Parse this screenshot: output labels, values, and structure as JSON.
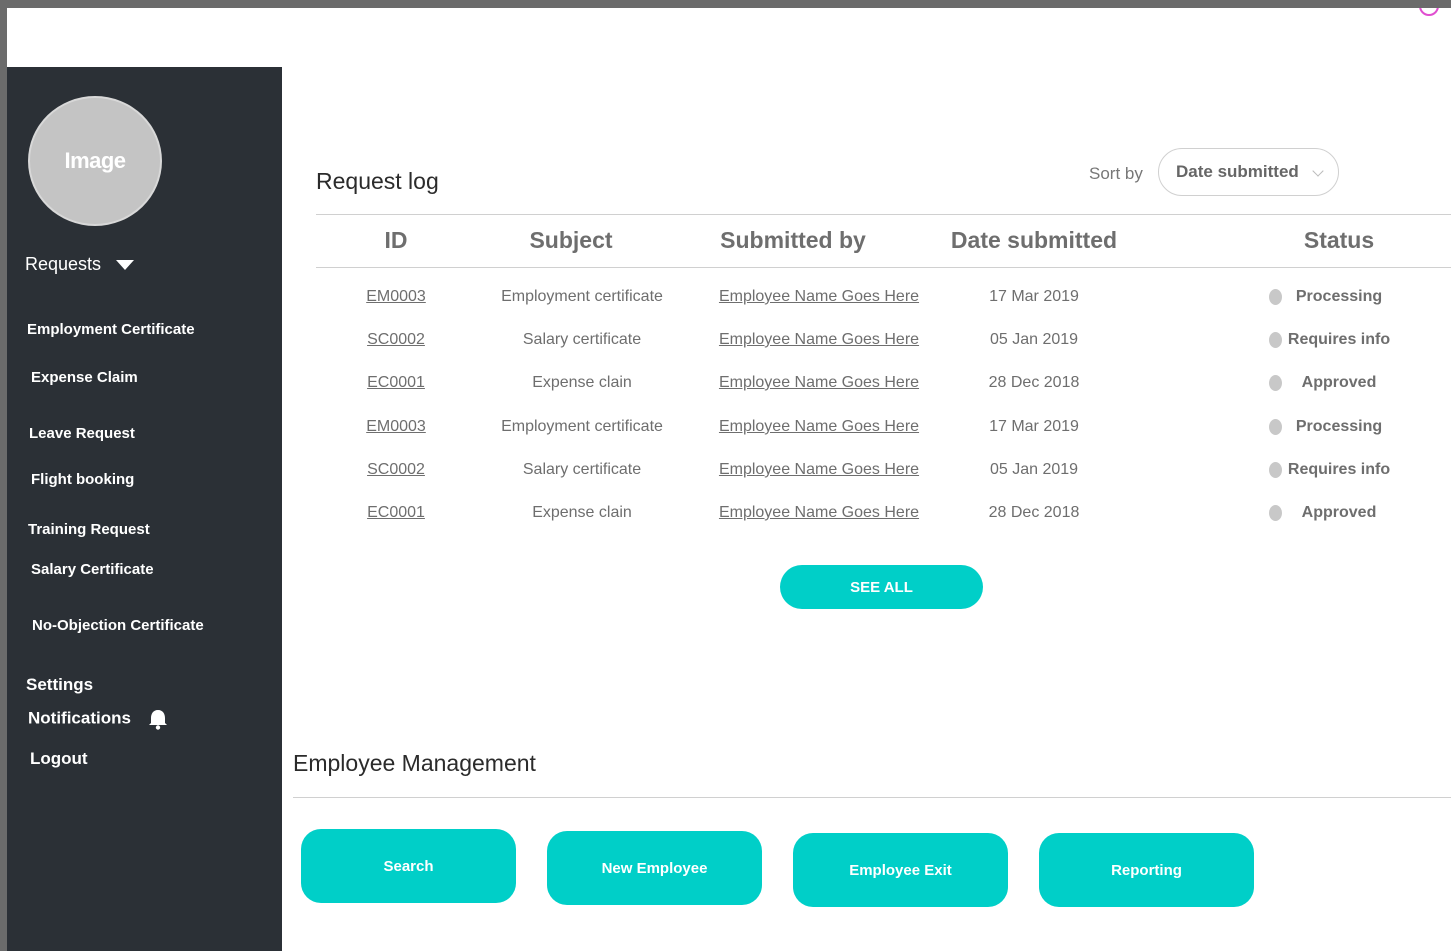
{
  "sidebar": {
    "avatar_label": "Image",
    "requests_label": "Requests",
    "items": [
      {
        "label": "Employment Certificate"
      },
      {
        "label": "Expense Claim"
      },
      {
        "label": "Leave Request"
      },
      {
        "label": "Flight booking"
      },
      {
        "label": "Training Request"
      },
      {
        "label": "Salary Certificate"
      },
      {
        "label": "No-Objection Certificate"
      }
    ],
    "settings_label": "Settings",
    "notifications_label": "Notifications",
    "logout_label": "Logout",
    "bell_icon": "bell-icon"
  },
  "request_log": {
    "title": "Request log",
    "sort_label": "Sort by",
    "sort_value": "Date submitted",
    "columns": [
      "ID",
      "Subject",
      "Submitted by",
      "Date submitted",
      "Status"
    ],
    "rows": [
      {
        "id": "EM0003",
        "subject": "Employment certificate",
        "submitted_by": "Employee Name Goes Here",
        "date": "17 Mar 2019",
        "status": "Processing"
      },
      {
        "id": "SC0002",
        "subject": "Salary certificate",
        "submitted_by": "Employee Name Goes Here",
        "date": "05 Jan 2019",
        "status": "Requires info"
      },
      {
        "id": "EC0001",
        "subject": "Expense clain",
        "submitted_by": "Employee Name Goes Here",
        "date": "28 Dec 2018",
        "status": "Approved"
      },
      {
        "id": "EM0003",
        "subject": "Employment certificate",
        "submitted_by": "Employee Name Goes Here",
        "date": "17 Mar 2019",
        "status": "Processing"
      },
      {
        "id": "SC0002",
        "subject": "Salary certificate",
        "submitted_by": "Employee Name Goes Here",
        "date": "05 Jan 2019",
        "status": "Requires info"
      },
      {
        "id": "EC0001",
        "subject": "Expense clain",
        "submitted_by": "Employee Name Goes Here",
        "date": "28 Dec 2018",
        "status": "Approved"
      }
    ],
    "see_all_label": "SEE ALL"
  },
  "employee_management": {
    "title": "Employee Management",
    "buttons": [
      "Search",
      "New Employee",
      "Employee Exit",
      "Reporting"
    ]
  },
  "colors": {
    "accent": "#00cfc8",
    "sidebar_bg": "#2b3036",
    "status_dot": "#c8c8c8"
  }
}
